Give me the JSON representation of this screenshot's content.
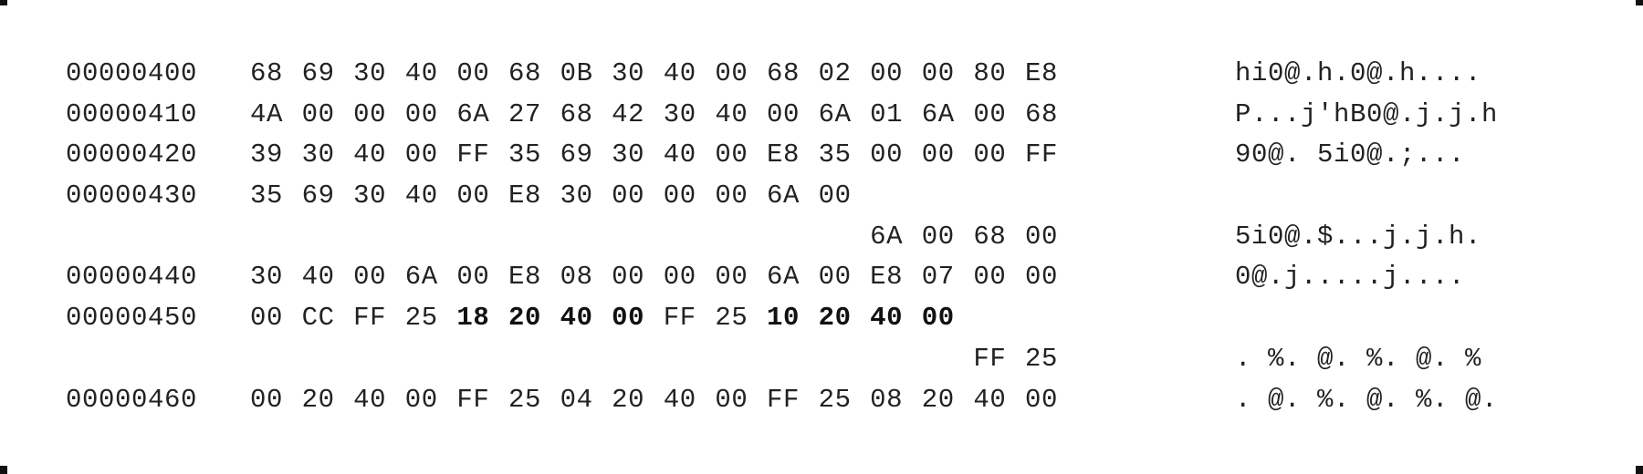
{
  "hex_dump": {
    "rows": [
      {
        "offset": "00000400",
        "bytes": [
          {
            "v": "68",
            "col": 0
          },
          {
            "v": "69",
            "col": 1
          },
          {
            "v": "30",
            "col": 2
          },
          {
            "v": "40",
            "col": 3
          },
          {
            "v": "00",
            "col": 4
          },
          {
            "v": "68",
            "col": 5
          },
          {
            "v": "0B",
            "col": 6
          },
          {
            "v": "30",
            "col": 7
          },
          {
            "v": "40",
            "col": 8
          },
          {
            "v": "00",
            "col": 9
          },
          {
            "v": "68",
            "col": 10
          },
          {
            "v": "02",
            "col": 11
          },
          {
            "v": "00",
            "col": 12
          },
          {
            "v": "00",
            "col": 13
          },
          {
            "v": "80",
            "col": 14
          },
          {
            "v": "E8",
            "col": 15
          }
        ],
        "ascii": "hi0@.h.0@.h...."
      },
      {
        "offset": "00000410",
        "bytes": [
          {
            "v": "4A",
            "col": 0
          },
          {
            "v": "00",
            "col": 1
          },
          {
            "v": "00",
            "col": 2
          },
          {
            "v": "00",
            "col": 3
          },
          {
            "v": "6A",
            "col": 4
          },
          {
            "v": "27",
            "col": 5
          },
          {
            "v": "68",
            "col": 6
          },
          {
            "v": "42",
            "col": 7
          },
          {
            "v": "30",
            "col": 8
          },
          {
            "v": "40",
            "col": 9
          },
          {
            "v": "00",
            "col": 10
          },
          {
            "v": "6A",
            "col": 11
          },
          {
            "v": "01",
            "col": 12
          },
          {
            "v": "6A",
            "col": 13
          },
          {
            "v": "00",
            "col": 14
          },
          {
            "v": "68",
            "col": 15
          }
        ],
        "ascii": "P...j'hB0@.j.j.h"
      },
      {
        "offset": "00000420",
        "bytes": [
          {
            "v": "39",
            "col": 0
          },
          {
            "v": "30",
            "col": 1
          },
          {
            "v": "40",
            "col": 2
          },
          {
            "v": "00",
            "col": 3
          },
          {
            "v": "FF",
            "col": 4
          },
          {
            "v": "35",
            "col": 5
          },
          {
            "v": "69",
            "col": 6
          },
          {
            "v": "30",
            "col": 7
          },
          {
            "v": "40",
            "col": 8
          },
          {
            "v": "00",
            "col": 9
          },
          {
            "v": "E8",
            "col": 10
          },
          {
            "v": "35",
            "col": 11
          },
          {
            "v": "00",
            "col": 12
          },
          {
            "v": "00",
            "col": 13
          },
          {
            "v": "00",
            "col": 14
          },
          {
            "v": "FF",
            "col": 15
          }
        ],
        "ascii": "90@. 5i0@.;..."
      },
      {
        "offset": "00000430",
        "bytes": [
          {
            "v": "35",
            "col": 0
          },
          {
            "v": "69",
            "col": 1
          },
          {
            "v": "30",
            "col": 2
          },
          {
            "v": "40",
            "col": 3
          },
          {
            "v": "00",
            "col": 4
          },
          {
            "v": "E8",
            "col": 5
          },
          {
            "v": "30",
            "col": 6
          },
          {
            "v": "00",
            "col": 7
          },
          {
            "v": "00",
            "col": 8
          },
          {
            "v": "00",
            "col": 9
          },
          {
            "v": "6A",
            "col": 10
          },
          {
            "v": "00",
            "col": 11
          }
        ],
        "ascii": ""
      },
      {
        "offset": "",
        "bytes": [
          {
            "v": "6A",
            "col": 12
          },
          {
            "v": "00",
            "col": 13
          },
          {
            "v": "68",
            "col": 14
          },
          {
            "v": "00",
            "col": 15
          }
        ],
        "ascii": "5i0@.$...j.j.h."
      },
      {
        "offset": "00000440",
        "bytes": [
          {
            "v": "30",
            "col": 0
          },
          {
            "v": "40",
            "col": 1
          },
          {
            "v": "00",
            "col": 2
          },
          {
            "v": "6A",
            "col": 3
          },
          {
            "v": "00",
            "col": 4
          },
          {
            "v": "E8",
            "col": 5
          },
          {
            "v": "08",
            "col": 6
          },
          {
            "v": "00",
            "col": 7
          },
          {
            "v": "00",
            "col": 8
          },
          {
            "v": "00",
            "col": 9
          },
          {
            "v": "6A",
            "col": 10
          },
          {
            "v": "00",
            "col": 11
          },
          {
            "v": "E8",
            "col": 12
          },
          {
            "v": "07",
            "col": 13
          },
          {
            "v": "00",
            "col": 14
          },
          {
            "v": "00",
            "col": 15
          }
        ],
        "ascii": "0@.j.....j...."
      },
      {
        "offset": "00000450",
        "bytes": [
          {
            "v": "00",
            "col": 0
          },
          {
            "v": "CC",
            "col": 1
          },
          {
            "v": "FF",
            "col": 2
          },
          {
            "v": "25",
            "col": 3
          },
          {
            "v": "18",
            "col": 4,
            "bold": true
          },
          {
            "v": "20",
            "col": 5,
            "bold": true
          },
          {
            "v": "40",
            "col": 6,
            "bold": true
          },
          {
            "v": "00",
            "col": 7,
            "bold": true
          },
          {
            "v": "FF",
            "col": 8
          },
          {
            "v": "25",
            "col": 9
          },
          {
            "v": "10",
            "col": 10,
            "bold": true
          },
          {
            "v": "20",
            "col": 11,
            "bold": true
          },
          {
            "v": "40",
            "col": 12,
            "bold": true
          },
          {
            "v": "00",
            "col": 13,
            "bold": true
          }
        ],
        "ascii": ""
      },
      {
        "offset": "",
        "bytes": [
          {
            "v": "FF",
            "col": 14
          },
          {
            "v": "25",
            "col": 15
          }
        ],
        "ascii": ". %. @. %. @. %"
      },
      {
        "offset": "00000460",
        "bytes": [
          {
            "v": "00",
            "col": 0
          },
          {
            "v": "20",
            "col": 1
          },
          {
            "v": "40",
            "col": 2
          },
          {
            "v": "00",
            "col": 3
          },
          {
            "v": "FF",
            "col": 4
          },
          {
            "v": "25",
            "col": 5
          },
          {
            "v": "04",
            "col": 6
          },
          {
            "v": "20",
            "col": 7
          },
          {
            "v": "40",
            "col": 8
          },
          {
            "v": "00",
            "col": 9
          },
          {
            "v": "FF",
            "col": 10
          },
          {
            "v": "25",
            "col": 11
          },
          {
            "v": "08",
            "col": 12
          },
          {
            "v": "20",
            "col": 13
          },
          {
            "v": "40",
            "col": 14
          },
          {
            "v": "00",
            "col": 15
          }
        ],
        "ascii": ". @. %. @. %. @."
      }
    ]
  }
}
